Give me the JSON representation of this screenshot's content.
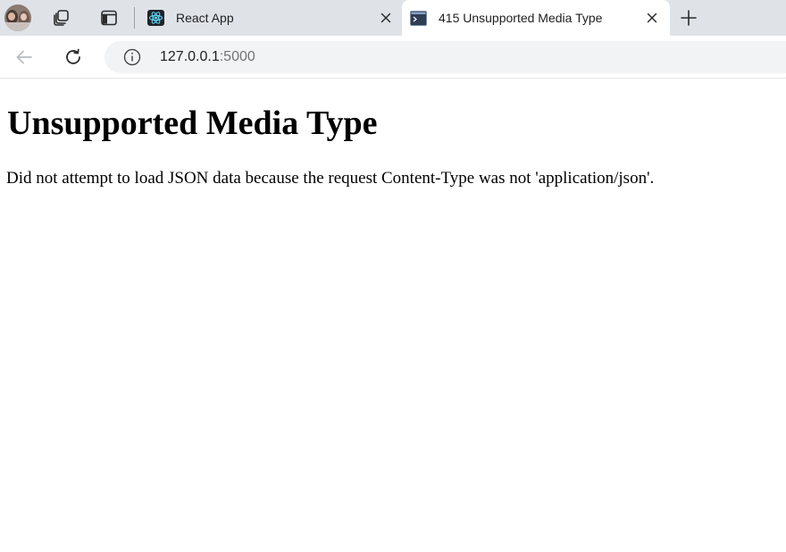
{
  "browser": {
    "profile": {
      "name": "profile-avatar"
    },
    "tabs": [
      {
        "title": "React App",
        "favicon": "react-icon",
        "active": false
      },
      {
        "title": "415 Unsupported Media Type",
        "favicon": "terminal-icon",
        "active": true
      }
    ],
    "address_bar": {
      "host": "127.0.0.1",
      "port": ":5000"
    },
    "colors": {
      "tabstrip_bg": "#dfe3e8",
      "active_tab_bg": "#ffffff",
      "omnibox_bg": "#f1f3f4",
      "react_blue": "#61dafb",
      "react_favicon_bg": "#20232a"
    }
  },
  "page": {
    "heading": "Unsupported Media Type",
    "message": "Did not attempt to load JSON data because the request Content-Type was not 'application/json'."
  }
}
